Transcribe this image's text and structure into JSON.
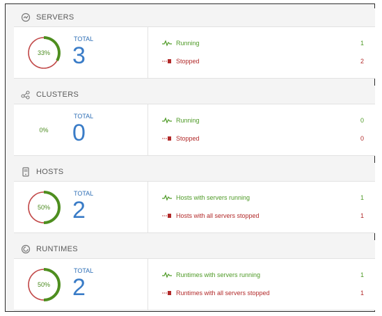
{
  "colors": {
    "running": "#4e9a26",
    "stopped": "#b22a2a",
    "total": "#3a7cc7",
    "donut_running": "#4e8e1f",
    "donut_stopped": "#c24a4a"
  },
  "sections": [
    {
      "id": "servers",
      "icon": "server-icon",
      "title": "SERVERS",
      "percent_label": "33%",
      "running_fraction": 0.333,
      "show_donut": true,
      "total_label": "TOTAL",
      "total": "3",
      "rows": [
        {
          "kind": "running",
          "label": "Running",
          "count": "1"
        },
        {
          "kind": "stopped",
          "label": "Stopped",
          "count": "2"
        }
      ]
    },
    {
      "id": "clusters",
      "icon": "share-nodes-icon",
      "title": "CLUSTERS",
      "percent_label": "0%",
      "running_fraction": 0,
      "show_donut": false,
      "total_label": "TOTAL",
      "total": "0",
      "rows": [
        {
          "kind": "running",
          "label": "Running",
          "count": "0"
        },
        {
          "kind": "stopped",
          "label": "Stopped",
          "count": "0"
        }
      ]
    },
    {
      "id": "hosts",
      "icon": "host-icon",
      "title": "HOSTS",
      "percent_label": "50%",
      "running_fraction": 0.5,
      "show_donut": true,
      "total_label": "TOTAL",
      "total": "2",
      "rows": [
        {
          "kind": "running",
          "label": "Hosts with servers running",
          "count": "1"
        },
        {
          "kind": "stopped",
          "label": "Hosts with all servers stopped",
          "count": "1"
        }
      ]
    },
    {
      "id": "runtimes",
      "icon": "runtime-icon",
      "title": "RUNTIMES",
      "percent_label": "50%",
      "running_fraction": 0.5,
      "show_donut": true,
      "total_label": "TOTAL",
      "total": "2",
      "rows": [
        {
          "kind": "running",
          "label": "Runtimes with servers running",
          "count": "1"
        },
        {
          "kind": "stopped",
          "label": "Runtimes with all servers stopped",
          "count": "1"
        }
      ]
    }
  ]
}
